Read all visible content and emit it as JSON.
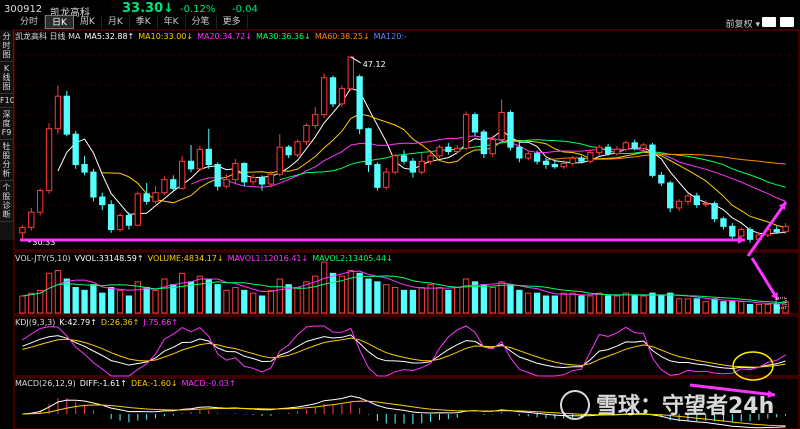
{
  "header": {
    "code": "300912",
    "name": "凯龙高科",
    "price": "33.30",
    "arrow": "↓",
    "change_pct": "-0.12%",
    "change": "-0.04",
    "right_label": "前复权"
  },
  "tabs": [
    "分时",
    "日K",
    "周K",
    "月K",
    "季K",
    "年K",
    "分笔",
    "更多"
  ],
  "active_tab": "日K",
  "sidebar": [
    "分时图",
    "K线图",
    "F10",
    "深度F9",
    "牡股分析",
    "个股诊断"
  ],
  "ma_legend": [
    {
      "text": "凯龙高科 日线 MA",
      "color": "#dddddd"
    },
    {
      "text": "MA5:32.88↑",
      "color": "#ffffff"
    },
    {
      "text": "MA10:33.00↓",
      "color": "#ffcc00"
    },
    {
      "text": "MA20:34.72↓",
      "color": "#ff33ff"
    },
    {
      "text": "MA30:36.36↓",
      "color": "#00ff66"
    },
    {
      "text": "MA60:38.25↓",
      "color": "#ff8800"
    },
    {
      "text": "MA120:-",
      "color": "#6688ff"
    }
  ],
  "vol_legend": [
    {
      "text": "VOL-JTY(5,10)",
      "color": "#dddddd"
    },
    {
      "text": "VVOL:33148.59↑",
      "color": "#ffffff"
    },
    {
      "text": "VOLUME:4834.17↓",
      "color": "#ffcc00"
    },
    {
      "text": "MAVOL1:12016.41↓",
      "color": "#ff33ff"
    },
    {
      "text": "MAVOL2:13405.44↓",
      "color": "#00ff66"
    }
  ],
  "kdj_legend": [
    {
      "text": "KDJ(9,3,3)",
      "color": "#dddddd"
    },
    {
      "text": "K:42.79↑",
      "color": "#ffffff"
    },
    {
      "text": "D:26.36↑",
      "color": "#ffcc00"
    },
    {
      "text": "J:75.66↑",
      "color": "#ff33ff"
    }
  ],
  "macd_legend": [
    {
      "text": "MACD(26,12,9)",
      "color": "#dddddd"
    },
    {
      "text": "DIFF:-1.61↑",
      "color": "#ffffff"
    },
    {
      "text": "DEA:-1.60↓",
      "color": "#ffcc00"
    },
    {
      "text": "MACD:-0.03↑",
      "color": "#ff33ff"
    }
  ],
  "watermark": "雪球：守望者24h",
  "chart_data": {
    "type": "candlestick",
    "high_label": "47.12",
    "low_label": "30.33",
    "price_range": [
      29.5,
      48.5
    ],
    "candles": [
      [
        30.9,
        31.4,
        30.33,
        31.6
      ],
      [
        31.4,
        32.8,
        31.1,
        33.2
      ],
      [
        32.8,
        34.8,
        32.5,
        35.0
      ],
      [
        34.8,
        40.5,
        34.5,
        41.0
      ],
      [
        40.5,
        43.5,
        40.0,
        44.5
      ],
      [
        43.5,
        40.0,
        39.8,
        44.0
      ],
      [
        40.0,
        37.2,
        36.8,
        40.3
      ],
      [
        37.2,
        36.5,
        36.2,
        38.0
      ],
      [
        36.5,
        34.2,
        33.8,
        36.8
      ],
      [
        34.2,
        33.5,
        33.0,
        34.6
      ],
      [
        33.5,
        31.2,
        30.9,
        33.9
      ],
      [
        31.2,
        32.5,
        31.0,
        32.7
      ],
      [
        32.5,
        31.6,
        31.2,
        32.8
      ],
      [
        31.6,
        34.5,
        31.5,
        34.7
      ],
      [
        34.5,
        33.8,
        33.5,
        35.5
      ],
      [
        33.8,
        34.6,
        33.6,
        35.2
      ],
      [
        34.6,
        35.8,
        34.4,
        36.1
      ],
      [
        35.8,
        35.0,
        34.7,
        36.2
      ],
      [
        35.0,
        37.5,
        34.9,
        38.0
      ],
      [
        37.5,
        36.8,
        36.5,
        39.0
      ],
      [
        36.8,
        38.6,
        36.6,
        38.9
      ],
      [
        38.6,
        37.2,
        36.8,
        40.5
      ],
      [
        37.2,
        35.2,
        34.8,
        37.4
      ],
      [
        35.2,
        35.8,
        35.0,
        36.3
      ],
      [
        35.8,
        37.3,
        35.5,
        37.7
      ],
      [
        37.3,
        35.6,
        35.2,
        37.4
      ],
      [
        35.6,
        36.0,
        35.3,
        36.3
      ],
      [
        36.0,
        35.4,
        34.8,
        36.2
      ],
      [
        35.4,
        36.3,
        35.1,
        36.6
      ],
      [
        36.3,
        38.8,
        36.1,
        40.0
      ],
      [
        38.8,
        38.1,
        37.8,
        39.0
      ],
      [
        38.1,
        39.3,
        37.9,
        39.5
      ],
      [
        39.3,
        40.8,
        39.0,
        41.0
      ],
      [
        40.8,
        41.8,
        40.5,
        42.5
      ],
      [
        41.8,
        45.2,
        41.5,
        45.6
      ],
      [
        45.2,
        42.8,
        42.5,
        45.4
      ],
      [
        42.8,
        44.2,
        42.5,
        44.5
      ],
      [
        44.2,
        47.12,
        44.0,
        47.12
      ],
      [
        45.3,
        40.5,
        40.0,
        45.5
      ],
      [
        40.5,
        37.2,
        36.5,
        40.6
      ],
      [
        37.2,
        35.1,
        34.8,
        37.4
      ],
      [
        35.1,
        36.5,
        34.9,
        36.9
      ],
      [
        36.5,
        38.0,
        36.3,
        38.2
      ],
      [
        38.0,
        37.5,
        37.2,
        38.5
      ],
      [
        37.5,
        36.5,
        36.0,
        37.8
      ],
      [
        36.5,
        37.5,
        36.3,
        38.3
      ],
      [
        37.5,
        38.0,
        37.2,
        38.5
      ],
      [
        38.0,
        38.8,
        37.8,
        39.0
      ],
      [
        38.8,
        38.4,
        38.1,
        39.2
      ],
      [
        38.4,
        38.7,
        38.2,
        39.0
      ],
      [
        38.7,
        41.8,
        38.5,
        42.1
      ],
      [
        41.8,
        40.2,
        39.8,
        42.0
      ],
      [
        40.2,
        38.2,
        37.8,
        40.4
      ],
      [
        38.2,
        39.5,
        37.9,
        39.9
      ],
      [
        39.5,
        42.0,
        39.2,
        43.2
      ],
      [
        42.0,
        38.8,
        38.5,
        42.2
      ],
      [
        38.8,
        37.8,
        37.4,
        39.2
      ],
      [
        37.8,
        38.2,
        37.6,
        38.5
      ],
      [
        38.2,
        37.5,
        37.2,
        38.5
      ],
      [
        37.5,
        37.2,
        36.8,
        37.8
      ],
      [
        37.2,
        37.0,
        36.8,
        37.5
      ],
      [
        37.0,
        37.3,
        36.8,
        37.6
      ],
      [
        37.3,
        37.8,
        37.1,
        38.0
      ],
      [
        37.8,
        37.5,
        37.3,
        38.0
      ],
      [
        37.5,
        38.3,
        37.3,
        38.5
      ],
      [
        38.3,
        38.8,
        38.0,
        39.0
      ],
      [
        38.8,
        38.2,
        38.0,
        39.1
      ],
      [
        38.2,
        38.6,
        38.0,
        38.9
      ],
      [
        38.6,
        39.2,
        38.4,
        39.4
      ],
      [
        39.2,
        38.7,
        38.5,
        39.5
      ],
      [
        38.7,
        39.0,
        38.5,
        39.2
      ],
      [
        39.0,
        36.2,
        36.0,
        39.2
      ],
      [
        36.2,
        35.5,
        35.2,
        36.5
      ],
      [
        35.5,
        33.2,
        32.8,
        35.7
      ],
      [
        33.2,
        33.8,
        32.9,
        34.0
      ],
      [
        33.8,
        34.3,
        33.5,
        34.5
      ],
      [
        34.3,
        33.5,
        33.2,
        34.6
      ],
      [
        33.5,
        33.6,
        33.3,
        33.9
      ],
      [
        33.6,
        32.2,
        31.9,
        33.8
      ],
      [
        32.2,
        31.5,
        31.2,
        32.4
      ],
      [
        31.5,
        30.6,
        30.3,
        31.8
      ],
      [
        30.6,
        31.2,
        30.4,
        31.4
      ],
      [
        31.2,
        30.3,
        30.0,
        31.4
      ],
      [
        30.3,
        30.7,
        30.1,
        30.9
      ],
      [
        30.7,
        31.2,
        30.5,
        31.4
      ],
      [
        31.2,
        31.0,
        30.8,
        31.5
      ],
      [
        31.0,
        31.5,
        30.8,
        31.8
      ]
    ],
    "volumes": [
      6,
      7,
      8,
      14,
      15,
      12,
      9,
      8,
      10,
      7,
      9,
      8,
      6,
      11,
      9,
      8,
      12,
      10,
      14,
      11,
      13,
      12,
      10,
      8,
      9,
      8,
      7,
      6,
      8,
      12,
      10,
      9,
      11,
      13,
      18,
      14,
      13,
      15,
      14,
      12,
      11,
      10,
      9,
      8,
      8,
      9,
      10,
      9,
      8,
      9,
      12,
      11,
      10,
      9,
      11,
      10,
      8,
      7,
      7,
      6,
      6,
      7,
      7,
      6,
      6,
      7,
      6,
      6,
      7,
      6,
      6,
      7,
      6,
      7,
      5,
      5,
      5,
      4,
      5,
      4,
      4,
      4,
      3,
      3,
      3,
      3,
      4
    ],
    "arrows": [
      {
        "from": [
          0.005,
          0.88
        ],
        "to": [
          0.935,
          0.88
        ]
      },
      {
        "from": [
          0.935,
          0.93
        ],
        "to": [
          0.985,
          0.68
        ]
      },
      {
        "from": [
          0.935,
          1.0
        ],
        "to": [
          0.97,
          1.35
        ]
      }
    ]
  }
}
